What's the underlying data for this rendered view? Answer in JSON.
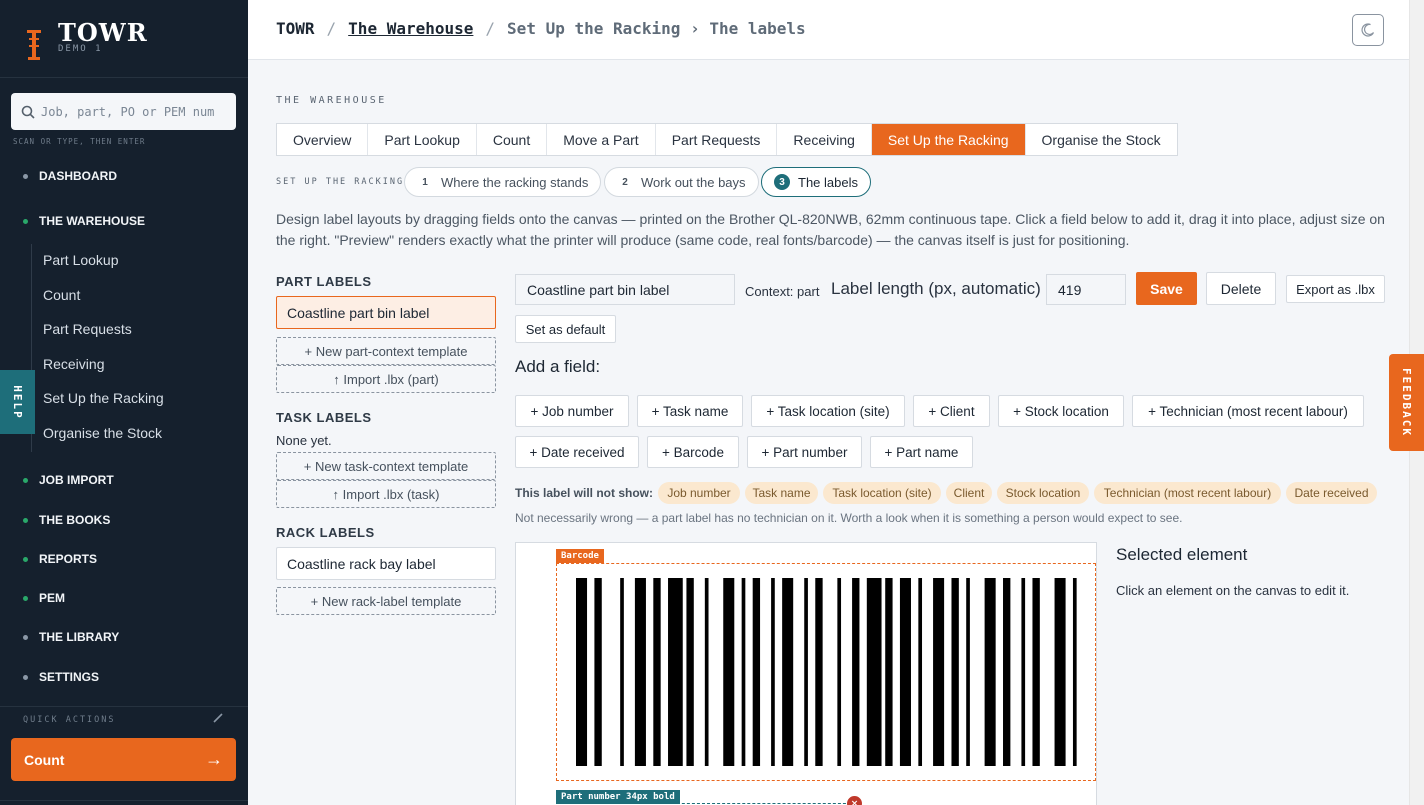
{
  "app": {
    "name": "TOWR",
    "subtitle": "DEMO 1"
  },
  "search": {
    "placeholder": "Job, part, PO or PEM num",
    "hint": "SCAN OR TYPE, THEN ENTER"
  },
  "nav": {
    "items": [
      {
        "label": "DASHBOARD",
        "dot": "#8a97a6"
      },
      {
        "label": "THE WAREHOUSE",
        "dot": "#2aa86a"
      },
      {
        "label": "JOB IMPORT",
        "dot": "#2aa86a"
      },
      {
        "label": "THE BOOKS",
        "dot": "#2aa86a"
      },
      {
        "label": "REPORTS",
        "dot": "#2aa86a"
      },
      {
        "label": "PEM",
        "dot": "#2aa86a"
      },
      {
        "label": "THE LIBRARY",
        "dot": "#8a97a6"
      },
      {
        "label": "SETTINGS",
        "dot": "#8a97a6"
      }
    ],
    "warehouse_sub": [
      "Part Lookup",
      "Count",
      "Part Requests",
      "Receiving",
      "Set Up the Racking",
      "Organise the Stock"
    ]
  },
  "quick_actions": {
    "label": "QUICK ACTIONS",
    "button": "Count",
    "arrow": "→"
  },
  "help_tab": "HELP",
  "feedback_tab": "FEEDBACK",
  "breadcrumb": {
    "root": "TOWR",
    "section": "The Warehouse",
    "page": "Set Up the Racking › The labels",
    "sep": "/"
  },
  "main": {
    "section_title": "THE WAREHOUSE",
    "tabs": [
      "Overview",
      "Part Lookup",
      "Count",
      "Move a Part",
      "Part Requests",
      "Receiving",
      "Set Up the Racking",
      "Organise the Stock"
    ],
    "active_tab": "Set Up the Racking",
    "steps_label": "SET UP THE RACKING",
    "steps": [
      {
        "n": "1",
        "label": "Where the racking stands"
      },
      {
        "n": "2",
        "label": "Work out the bays"
      },
      {
        "n": "3",
        "label": "The labels"
      }
    ],
    "description": "Design label layouts by dragging fields onto the canvas — printed on the Brother QL-820NWB, 62mm continuous tape. Click a field below to add it, drag it into place, adjust size on the right. \"Preview\" renders exactly what the printer will produce (same code, real fonts/barcode) — the canvas itself is just for positioning."
  },
  "templates": {
    "part_title": "PART LABELS",
    "part_items": [
      "Coastline part bin label"
    ],
    "part_new": "+ New part-context template",
    "part_import": "↑ Import .lbx (part)",
    "task_title": "TASK LABELS",
    "task_none": "None yet.",
    "task_new": "+ New task-context template",
    "task_import": "↑ Import .lbx (task)",
    "rack_title": "RACK LABELS",
    "rack_items": [
      "Coastline rack bay label"
    ],
    "rack_new": "+ New rack-label template"
  },
  "editor": {
    "name_value": "Coastline part bin label",
    "context": "Context: part",
    "length_label": "Label length (px, automatic)",
    "length_value": "419",
    "save": "Save",
    "delete": "Delete",
    "export": "Export as .lbx",
    "set_default": "Set as default",
    "add_field_title": "Add a field:",
    "fields": [
      "+ Job number",
      "+ Task name",
      "+ Task location (site)",
      "+ Client",
      "+ Stock location",
      "+ Technician (most recent labour)",
      "+ Date received",
      "+ Barcode",
      "+ Part number",
      "+ Part name"
    ],
    "warn_label": "This label will not show:",
    "warn_chips": [
      "Job number",
      "Task name",
      "Task location (site)",
      "Client",
      "Stock location",
      "Technician (most recent labour)",
      "Date received"
    ],
    "warn_note": "Not necessarily wrong — a part label has no technician on it. Worth a look when it is something a person would expect to see.",
    "canvas_el1": "Barcode",
    "canvas_el2": "Part number 34px bold",
    "canvas_del": "×",
    "selected_title": "Selected element",
    "selected_note": "Click an element on the canvas to edit it."
  },
  "colors": {
    "accent": "#e8671e",
    "teal": "#1e6e7a",
    "sidebar": "#15202d"
  }
}
